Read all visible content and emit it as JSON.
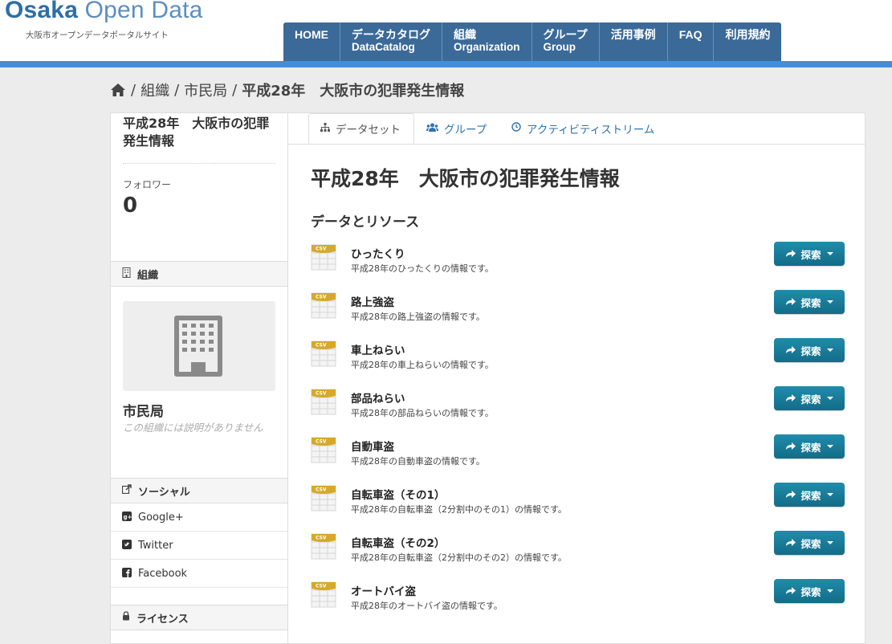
{
  "header": {
    "logo_bold": "Osaka",
    "logo_light": "Open Data",
    "tagline": "大阪市オープンデータポータルサイト",
    "nav": [
      {
        "label": "HOME",
        "sub": ""
      },
      {
        "label": "データカタログ",
        "sub": "DataCatalog"
      },
      {
        "label": "組織",
        "sub": "Organization"
      },
      {
        "label": "グループ",
        "sub": "Group"
      },
      {
        "label": "活用事例",
        "sub": ""
      },
      {
        "label": "FAQ",
        "sub": ""
      },
      {
        "label": "利用規約",
        "sub": ""
      }
    ]
  },
  "breadcrumb": {
    "sep": "/",
    "items": [
      "組織",
      "市民局",
      "平成28年　大阪市の犯罪発生情報"
    ]
  },
  "sidebar": {
    "title": "平成28年　大阪市の犯罪発生情報",
    "followers_label": "フォロワー",
    "followers_count": "0",
    "org_section": "組織",
    "org_name": "市民局",
    "org_desc": "この組織には説明がありません",
    "social_section": "ソーシャル",
    "social": [
      {
        "label": "Google+",
        "icon": "google-plus-icon"
      },
      {
        "label": "Twitter",
        "icon": "twitter-icon"
      },
      {
        "label": "Facebook",
        "icon": "facebook-icon"
      }
    ],
    "license_section": "ライセンス"
  },
  "tabs": [
    {
      "label": "データセット",
      "icon": "sitemap-icon"
    },
    {
      "label": "グループ",
      "icon": "users-icon"
    },
    {
      "label": "アクティビティストリーム",
      "icon": "clock-icon"
    }
  ],
  "main": {
    "title": "平成28年　大阪市の犯罪発生情報",
    "section_title": "データとリソース",
    "explore_label": "探索",
    "csv_label": "CSV",
    "resources": [
      {
        "name": "ひったくり",
        "desc": "平成28年のひったくりの情報です。"
      },
      {
        "name": "路上強盗",
        "desc": "平成28年の路上強盗の情報です。"
      },
      {
        "name": "車上ねらい",
        "desc": "平成28年の車上ねらいの情報です。"
      },
      {
        "name": "部品ねらい",
        "desc": "平成28年の部品ねらいの情報です。"
      },
      {
        "name": "自動車盗",
        "desc": "平成28年の自動車盗の情報です。"
      },
      {
        "name": "自転車盗（その1）",
        "desc": "平成28年の自転車盗（2分割中のその1）の情報です。"
      },
      {
        "name": "自転車盗（その2）",
        "desc": "平成28年の自転車盗（2分割中のその2）の情報です。"
      },
      {
        "name": "オートバイ盗",
        "desc": "平成28年のオートバイ盗の情報です。"
      }
    ]
  },
  "colors": {
    "nav_bg": "#3b6a98",
    "accent_bar": "#3f8fd9",
    "button": "#1a7d9b",
    "link": "#2d73b0"
  }
}
